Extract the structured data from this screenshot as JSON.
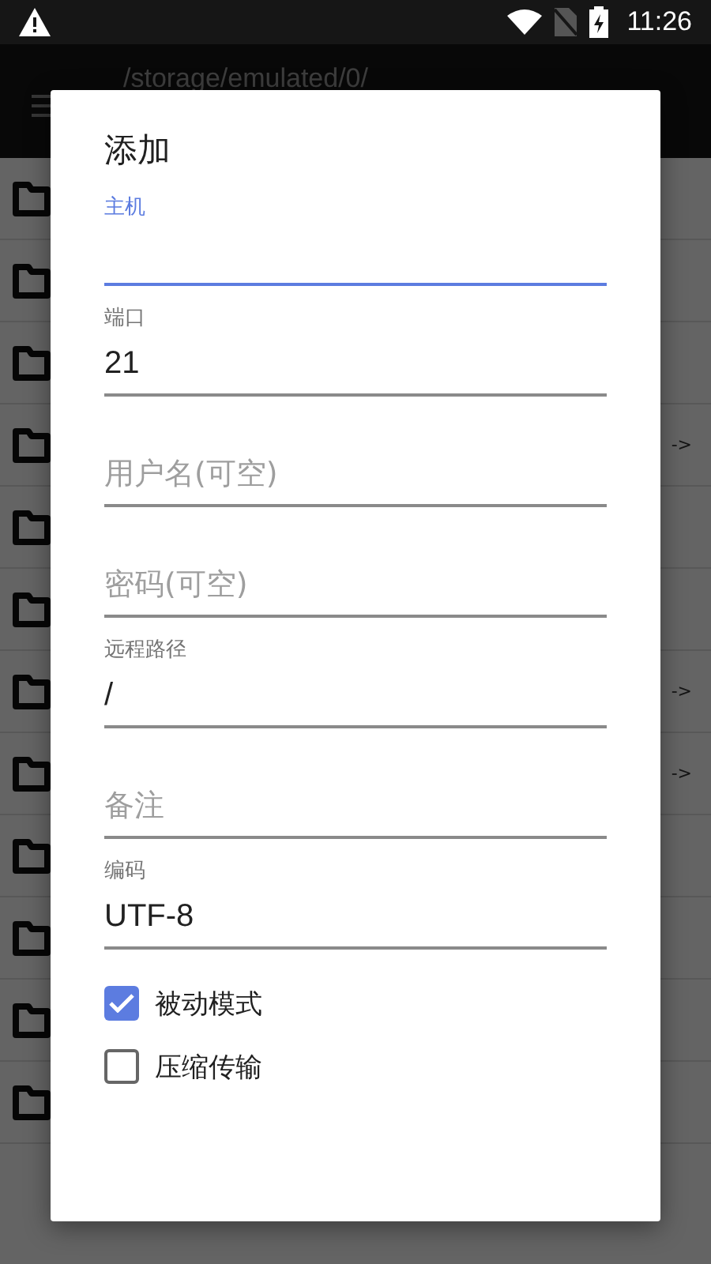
{
  "status_bar": {
    "time": "11:26"
  },
  "app_bar": {
    "title": "/storage/emulated/0/"
  },
  "file_list": {
    "rows": [
      {
        "arrow": null
      },
      {
        "arrow": null
      },
      {
        "arrow": null
      },
      {
        "arrow": "->"
      },
      {
        "arrow": null
      },
      {
        "arrow": null
      },
      {
        "arrow": "->"
      },
      {
        "arrow": "->"
      },
      {
        "arrow": null
      },
      {
        "arrow": null
      },
      {
        "arrow": null
      },
      {
        "arrow": null
      }
    ]
  },
  "dialog": {
    "title": "添加",
    "fields": [
      {
        "label": "主机",
        "focused": true
      },
      {
        "label": "端口",
        "value": "21",
        "focused": false
      },
      {
        "placeholder": "用户名(可空)",
        "focused": false
      },
      {
        "placeholder": "密码(可空)",
        "focused": false
      },
      {
        "label": "远程路径",
        "value": "/",
        "focused": false
      },
      {
        "placeholder": "备注",
        "focused": false
      },
      {
        "label": "编码",
        "value": "UTF-8",
        "focused": false
      }
    ],
    "checkboxes": [
      {
        "label": "被动模式",
        "checked": true
      },
      {
        "label": "压缩传输",
        "checked": false
      }
    ]
  }
}
